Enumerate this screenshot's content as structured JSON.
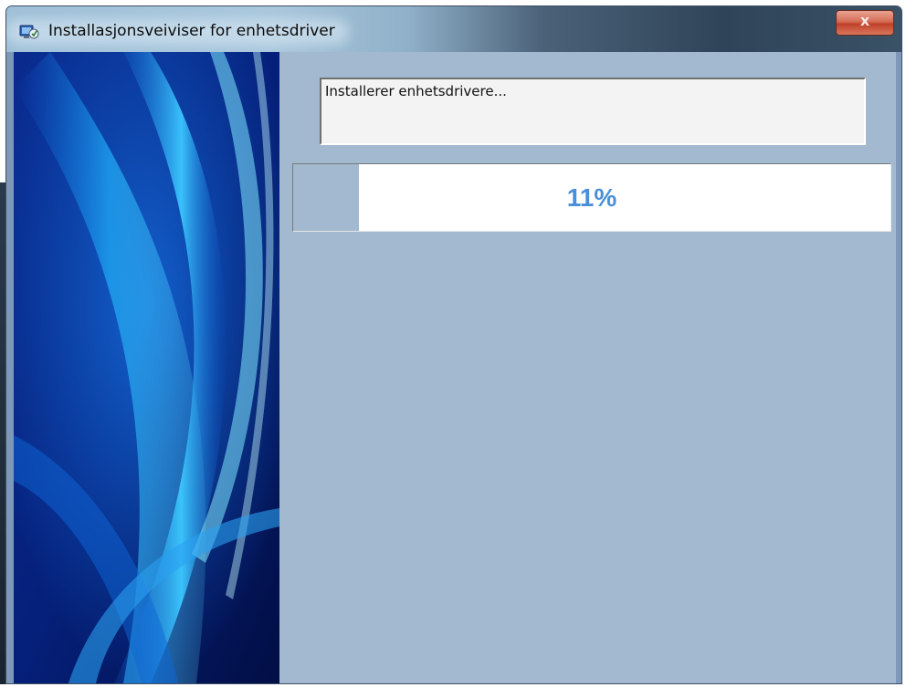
{
  "window": {
    "title": "Installasjonsveiviser for enhetsdriver",
    "close_label": "x",
    "app_icon": "installer-icon"
  },
  "status": {
    "text": "Installerer enhetsdrivere..."
  },
  "progress": {
    "value_percent": 11,
    "label": "11%",
    "fill_color": "#a2b9d0",
    "text_color": "#4a8fd8"
  },
  "colors": {
    "client_background": "#a2b9d0",
    "banner_dark": "#041a6e",
    "banner_light": "#3cc8ff"
  }
}
